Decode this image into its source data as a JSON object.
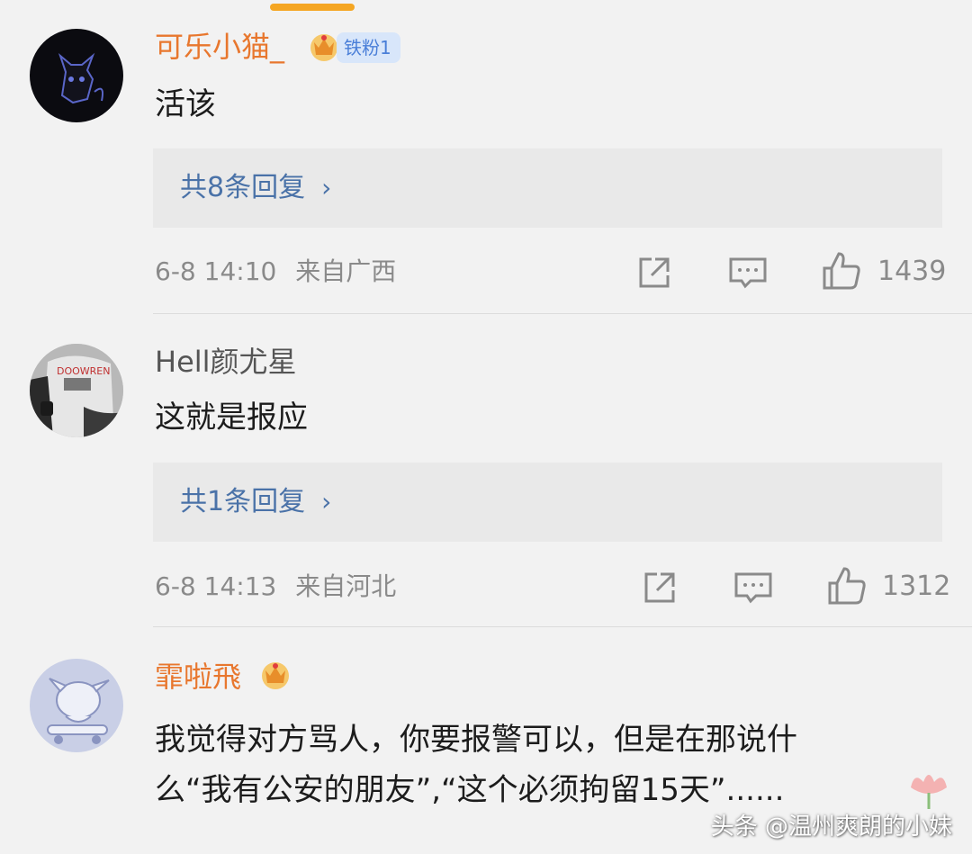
{
  "colors": {
    "background": "#f2f2f2",
    "username_highlight": "#e8772e",
    "reply_link": "#4a72a8",
    "meta_text": "#8a8a8a",
    "badge_bg": "#d8e6fa",
    "badge_text": "#4a7fd8"
  },
  "comments": [
    {
      "username": "可乐小猫_",
      "badges": [
        "crown-icon",
        "铁粉1"
      ],
      "text": "活该",
      "reply_label": "共8条回复",
      "date": "6-8 14:10",
      "location": "来自广西",
      "likes": "1439"
    },
    {
      "username": "Hell颜尤星",
      "badges": [],
      "text": "这就是报应",
      "reply_label": "共1条回复",
      "date": "6-8 14:13",
      "location": "来自河北",
      "likes": "1312"
    },
    {
      "username": "霏啦飛",
      "badges": [
        "crown-icon"
      ],
      "text_line1": "我觉得对方骂人，你要报警可以，但是在那说什",
      "text_line2": "么“我有公安的朋友”,“这个必须拘留15天”......"
    }
  ],
  "icons": [
    "share-icon",
    "comment-icon",
    "thumbs-up-icon",
    "chevron-right-icon"
  ],
  "watermark": "头条 @温州爽朗的小妹"
}
